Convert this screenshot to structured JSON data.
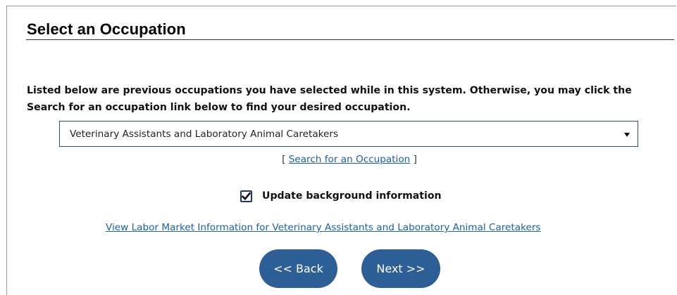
{
  "page": {
    "title": "Select an Occupation",
    "instructions": "Listed below are previous occupations you have selected while in this system. Otherwise, you may click the Search for an occupation link below to find your desired occupation."
  },
  "occupation_select": {
    "selected": "Veterinary Assistants and Laboratory Animal Caretakers"
  },
  "search_link": {
    "open_bracket": "[",
    "label": "Search for an Occupation",
    "close_bracket": "]"
  },
  "background_checkbox": {
    "checked": true,
    "label": "Update background information"
  },
  "lmi_link": {
    "label": "View Labor Market Information for Veterinary Assistants and Laboratory Animal Caretakers"
  },
  "buttons": {
    "back": "<< Back",
    "next": "Next >>"
  },
  "colors": {
    "button_bg": "#2d5f97",
    "link": "#1a5fb4",
    "select_border": "#1f4e79"
  },
  "icons": {
    "dropdown": "caret-down-icon",
    "checkbox": "checkmark-icon"
  }
}
